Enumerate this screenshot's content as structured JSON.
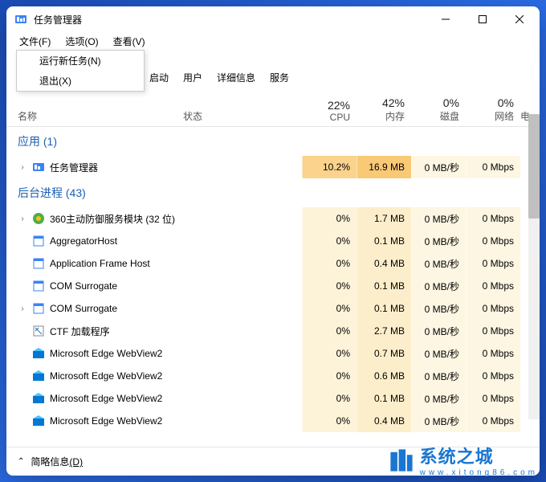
{
  "window": {
    "title": "任务管理器"
  },
  "menubar": {
    "file": "文件(F)",
    "options": "选项(O)",
    "view": "查看(V)"
  },
  "file_menu": {
    "run_new": "运行新任务(N)",
    "exit": "退出(X)"
  },
  "tabs": {
    "startup": "启动",
    "users": "用户",
    "details": "详细信息",
    "services": "服务"
  },
  "columns": {
    "name": "名称",
    "status": "状态",
    "cpu_pct": "22%",
    "cpu": "CPU",
    "mem_pct": "42%",
    "mem": "内存",
    "disk_pct": "0%",
    "disk": "磁盘",
    "net_pct": "0%",
    "net": "网络",
    "extra": "电"
  },
  "groups": {
    "apps": "应用 (1)",
    "bg": "后台进程 (43)"
  },
  "rows": [
    {
      "name": "任务管理器",
      "cpu": "10.2%",
      "mem": "16.9 MB",
      "disk": "0 MB/秒",
      "net": "0 Mbps",
      "exp": true,
      "icon": "tm",
      "hi": true
    },
    {
      "name": "360主动防御服务模块 (32 位)",
      "cpu": "0%",
      "mem": "1.7 MB",
      "disk": "0 MB/秒",
      "net": "0 Mbps",
      "exp": true,
      "icon": "360"
    },
    {
      "name": "AggregatorHost",
      "cpu": "0%",
      "mem": "0.1 MB",
      "disk": "0 MB/秒",
      "net": "0 Mbps",
      "icon": "exe"
    },
    {
      "name": "Application Frame Host",
      "cpu": "0%",
      "mem": "0.4 MB",
      "disk": "0 MB/秒",
      "net": "0 Mbps",
      "icon": "exe"
    },
    {
      "name": "COM Surrogate",
      "cpu": "0%",
      "mem": "0.1 MB",
      "disk": "0 MB/秒",
      "net": "0 Mbps",
      "icon": "exe"
    },
    {
      "name": "COM Surrogate",
      "cpu": "0%",
      "mem": "0.1 MB",
      "disk": "0 MB/秒",
      "net": "0 Mbps",
      "exp": true,
      "icon": "exe"
    },
    {
      "name": "CTF 加载程序",
      "cpu": "0%",
      "mem": "2.7 MB",
      "disk": "0 MB/秒",
      "net": "0 Mbps",
      "icon": "ctf"
    },
    {
      "name": "Microsoft Edge WebView2",
      "cpu": "0%",
      "mem": "0.7 MB",
      "disk": "0 MB/秒",
      "net": "0 Mbps",
      "icon": "edge"
    },
    {
      "name": "Microsoft Edge WebView2",
      "cpu": "0%",
      "mem": "0.6 MB",
      "disk": "0 MB/秒",
      "net": "0 Mbps",
      "icon": "edge"
    },
    {
      "name": "Microsoft Edge WebView2",
      "cpu": "0%",
      "mem": "0.1 MB",
      "disk": "0 MB/秒",
      "net": "0 Mbps",
      "icon": "edge"
    },
    {
      "name": "Microsoft Edge WebView2",
      "cpu": "0%",
      "mem": "0.4 MB",
      "disk": "0 MB/秒",
      "net": "0 Mbps",
      "icon": "edge"
    }
  ],
  "footer": {
    "brief": "简略信息",
    "brief_key": "(D)"
  },
  "watermark": {
    "text": "系统之城",
    "url": "www.xitong86.com"
  }
}
